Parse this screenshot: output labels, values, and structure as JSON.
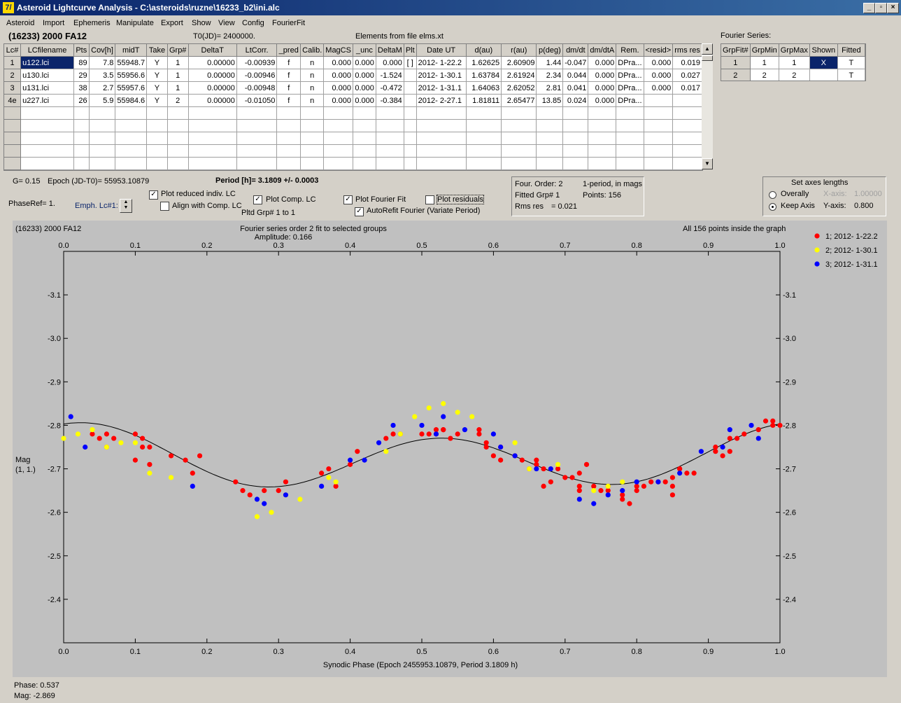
{
  "window": {
    "title": "Asteroid Lightcurve Analysis - C:\\asteroids\\ruzne\\16233_b2\\ini.alc",
    "icon": "7/",
    "controls": [
      "_",
      "▫",
      "×"
    ]
  },
  "menu": [
    "Asteroid",
    "Import",
    "Ephemeris",
    "Manipulate",
    "Export",
    "Show",
    "View",
    "Config",
    "FourierFit"
  ],
  "header": {
    "asteroid": "(16233) 2000 FA12",
    "t0": "T0(JD)= 2400000.",
    "elements": "Elements from file elms.xt",
    "fourier_label": "Fourier Series:"
  },
  "lc_table": {
    "columns": [
      "Lc#",
      "LCfilename",
      "Pts",
      "Cov[h]",
      "midT",
      "Take",
      "Grp#",
      "DeltaT",
      "LtCorr.",
      "_pred",
      "Calib.",
      "MagCS",
      "_unc",
      "DeltaM",
      "Plt",
      "Date UT",
      "d(au)",
      "r(au)",
      "p(deg)",
      "dm/dt",
      "dm/dtA",
      "Rem.",
      "<resid>",
      "rms res"
    ],
    "rows": [
      [
        "1",
        "u122.lci",
        "89",
        "7.8",
        "55948.7",
        "Y",
        "1",
        "0.00000",
        "-0.00939",
        "f",
        "n",
        "0.000",
        "0.000",
        "0.000",
        "[ ]",
        "2012- 1-22.2",
        "1.62625",
        "2.60909",
        "1.44",
        "-0.047",
        "0.000",
        "DPra...",
        "0.000",
        "0.019"
      ],
      [
        "2",
        "u130.lci",
        "29",
        "3.5",
        "55956.6",
        "Y",
        "1",
        "0.00000",
        "-0.00946",
        "f",
        "n",
        "0.000",
        "0.000",
        "-1.524",
        "",
        "2012- 1-30.1",
        "1.63784",
        "2.61924",
        "2.34",
        "0.044",
        "0.000",
        "DPra...",
        "0.000",
        "0.027"
      ],
      [
        "3",
        "u131.lci",
        "38",
        "2.7",
        "55957.6",
        "Y",
        "1",
        "0.00000",
        "-0.00948",
        "f",
        "n",
        "0.000",
        "0.000",
        "-0.472",
        "",
        "2012- 1-31.1",
        "1.64063",
        "2.62052",
        "2.81",
        "0.041",
        "0.000",
        "DPra...",
        "0.000",
        "0.017"
      ],
      [
        "4e",
        "u227.lci",
        "26",
        "5.9",
        "55984.6",
        "Y",
        "2",
        "0.00000",
        "-0.01050",
        "f",
        "n",
        "0.000",
        "0.000",
        "-0.384",
        "",
        "2012- 2-27.1",
        "1.81811",
        "2.65477",
        "13.85",
        "0.024",
        "0.000",
        "DPra...",
        "",
        ""
      ]
    ],
    "empty_rows": 5
  },
  "fourier_table": {
    "columns": [
      "GrpFit#",
      "GrpMin",
      "GrpMax",
      "Shown",
      "Fitted"
    ],
    "rows": [
      [
        "1",
        "1",
        "1",
        "X",
        "T"
      ],
      [
        "2",
        "2",
        "2",
        "",
        "T"
      ]
    ]
  },
  "info": {
    "g": "G= 0.15",
    "epoch": "Epoch (JD-T0)= 55953.10879",
    "period": "Period [h]= 3.1809 +/- 0.0003",
    "phaseref": "PhaseRef= 1.",
    "emph": "Emph. Lc#1:",
    "pltd_grp": "Pltd Grp#  1   to    1"
  },
  "options": {
    "plot_reduced": {
      "label": "Plot reduced indiv. LC",
      "checked": true
    },
    "align": {
      "label": "Align with Comp. LC",
      "checked": false
    },
    "plot_comp": {
      "label": "Plot Comp. LC",
      "checked": true
    },
    "plot_fourier": {
      "label": "Plot Fourier Fit",
      "checked": true
    },
    "plot_residuals": {
      "label": "Plot residuals",
      "checked": false
    },
    "autorefit": {
      "label": "AutoRefit Fourier (Variate Period)",
      "checked": true
    }
  },
  "fourier_info": {
    "order": "Four. Order:  2",
    "mode": "1-period, in mags",
    "fitted": "Fitted Grp# 1",
    "points": "Points: 156",
    "rms_label": "Rms res",
    "rms_value": "= 0.021"
  },
  "axes_panel": {
    "title": "Set axes lengths",
    "overally": "Overally",
    "keep": "Keep Axis",
    "xaxis_label": "X-axis:",
    "xaxis_value": "1.00000",
    "yaxis_label": "Y-axis:",
    "yaxis_value": "0.800",
    "selected": "keep"
  },
  "plot": {
    "top_left": "(16233) 2000 FA12",
    "title": "Fourier series order 2 fit to selected groups",
    "subtitle": "Amplitude: 0.166",
    "top_right": "All 156 points inside the graph",
    "ylabel_line1": "Mag",
    "ylabel_line2": "(1, 1.)",
    "xlabel": "Synodic Phase (Epoch 2455953.10879, Period 3.1809 h)"
  },
  "status": {
    "phase": "Phase:  0.537",
    "mag": "Mag:    -2.869"
  },
  "chart_data": {
    "type": "scatter",
    "xlim": [
      0,
      1
    ],
    "ylim": [
      -3.2,
      -2.3
    ],
    "y_inverted": true,
    "x_ticks": [
      "0.0",
      "0.1",
      "0.2",
      "0.3",
      "0.4",
      "0.5",
      "0.6",
      "0.7",
      "0.8",
      "0.9",
      "1.0"
    ],
    "y_ticks": [
      "-3.1",
      "-3.0",
      "-2.9",
      "-2.8",
      "-2.7",
      "-2.6",
      "-2.5",
      "-2.4"
    ],
    "fit": {
      "label": "Fourier fit",
      "color": "#000000",
      "mean": -2.725,
      "a1": -0.018,
      "b1": 0.0,
      "a2": -0.06,
      "b2": -0.02
    },
    "series": [
      {
        "name": "1; 2012- 1-22.2",
        "color": "#ff0000",
        "points": [
          [
            0.04,
            -2.78
          ],
          [
            0.05,
            -2.77
          ],
          [
            0.06,
            -2.78
          ],
          [
            0.06,
            -2.75
          ],
          [
            0.07,
            -2.77
          ],
          [
            0.1,
            -2.72
          ],
          [
            0.1,
            -2.78
          ],
          [
            0.11,
            -2.75
          ],
          [
            0.11,
            -2.77
          ],
          [
            0.12,
            -2.71
          ],
          [
            0.12,
            -2.75
          ],
          [
            0.15,
            -2.73
          ],
          [
            0.17,
            -2.72
          ],
          [
            0.18,
            -2.69
          ],
          [
            0.19,
            -2.73
          ],
          [
            0.24,
            -2.67
          ],
          [
            0.25,
            -2.65
          ],
          [
            0.26,
            -2.64
          ],
          [
            0.28,
            -2.65
          ],
          [
            0.3,
            -2.65
          ],
          [
            0.31,
            -2.67
          ],
          [
            0.36,
            -2.69
          ],
          [
            0.37,
            -2.7
          ],
          [
            0.38,
            -2.66
          ],
          [
            0.4,
            -2.71
          ],
          [
            0.41,
            -2.74
          ],
          [
            0.45,
            -2.77
          ],
          [
            0.46,
            -2.78
          ],
          [
            0.47,
            -2.78
          ],
          [
            0.5,
            -2.78
          ],
          [
            0.51,
            -2.78
          ],
          [
            0.52,
            -2.79
          ],
          [
            0.52,
            -2.78
          ],
          [
            0.53,
            -2.79
          ],
          [
            0.53,
            -2.79
          ],
          [
            0.54,
            -2.77
          ],
          [
            0.55,
            -2.78
          ],
          [
            0.58,
            -2.79
          ],
          [
            0.58,
            -2.78
          ],
          [
            0.59,
            -2.76
          ],
          [
            0.59,
            -2.75
          ],
          [
            0.6,
            -2.73
          ],
          [
            0.61,
            -2.75
          ],
          [
            0.61,
            -2.72
          ],
          [
            0.63,
            -2.73
          ],
          [
            0.64,
            -2.72
          ],
          [
            0.65,
            -2.7
          ],
          [
            0.66,
            -2.72
          ],
          [
            0.66,
            -2.71
          ],
          [
            0.67,
            -2.66
          ],
          [
            0.67,
            -2.7
          ],
          [
            0.68,
            -2.67
          ],
          [
            0.69,
            -2.7
          ],
          [
            0.7,
            -2.68
          ],
          [
            0.71,
            -2.68
          ],
          [
            0.72,
            -2.69
          ],
          [
            0.72,
            -2.66
          ],
          [
            0.72,
            -2.65
          ],
          [
            0.73,
            -2.71
          ],
          [
            0.74,
            -2.66
          ],
          [
            0.75,
            -2.65
          ],
          [
            0.76,
            -2.66
          ],
          [
            0.76,
            -2.65
          ],
          [
            0.78,
            -2.64
          ],
          [
            0.78,
            -2.63
          ],
          [
            0.79,
            -2.62
          ],
          [
            0.8,
            -2.65
          ],
          [
            0.8,
            -2.66
          ],
          [
            0.81,
            -2.66
          ],
          [
            0.82,
            -2.67
          ],
          [
            0.83,
            -2.67
          ],
          [
            0.84,
            -2.67
          ],
          [
            0.85,
            -2.64
          ],
          [
            0.85,
            -2.68
          ],
          [
            0.85,
            -2.66
          ],
          [
            0.86,
            -2.7
          ],
          [
            0.86,
            -2.7
          ],
          [
            0.87,
            -2.69
          ],
          [
            0.88,
            -2.69
          ],
          [
            0.91,
            -2.74
          ],
          [
            0.91,
            -2.75
          ],
          [
            0.92,
            -2.73
          ],
          [
            0.93,
            -2.77
          ],
          [
            0.93,
            -2.74
          ],
          [
            0.94,
            -2.77
          ],
          [
            0.95,
            -2.78
          ],
          [
            0.97,
            -2.79
          ],
          [
            0.98,
            -2.81
          ],
          [
            0.99,
            -2.81
          ],
          [
            0.99,
            -2.8
          ],
          [
            1.0,
            -2.8
          ]
        ]
      },
      {
        "name": "2; 2012- 1-30.1",
        "color": "#ffff00",
        "points": [
          [
            0.0,
            -2.77
          ],
          [
            0.02,
            -2.78
          ],
          [
            0.04,
            -2.79
          ],
          [
            0.06,
            -2.75
          ],
          [
            0.08,
            -2.76
          ],
          [
            0.1,
            -2.76
          ],
          [
            0.12,
            -2.69
          ],
          [
            0.15,
            -2.68
          ],
          [
            0.27,
            -2.59
          ],
          [
            0.29,
            -2.6
          ],
          [
            0.31,
            -2.64
          ],
          [
            0.33,
            -2.63
          ],
          [
            0.37,
            -2.68
          ],
          [
            0.38,
            -2.67
          ],
          [
            0.45,
            -2.74
          ],
          [
            0.47,
            -2.78
          ],
          [
            0.49,
            -2.82
          ],
          [
            0.51,
            -2.84
          ],
          [
            0.53,
            -2.85
          ],
          [
            0.55,
            -2.83
          ],
          [
            0.57,
            -2.82
          ],
          [
            0.63,
            -2.76
          ],
          [
            0.65,
            -2.7
          ],
          [
            0.69,
            -2.71
          ],
          [
            0.74,
            -2.65
          ],
          [
            0.76,
            -2.66
          ],
          [
            0.78,
            -2.67
          ]
        ]
      },
      {
        "name": "3; 2012- 1-31.1",
        "color": "#0000ff",
        "points": [
          [
            0.01,
            -2.82
          ],
          [
            0.03,
            -2.75
          ],
          [
            0.18,
            -2.66
          ],
          [
            0.27,
            -2.63
          ],
          [
            0.28,
            -2.62
          ],
          [
            0.31,
            -2.64
          ],
          [
            0.36,
            -2.66
          ],
          [
            0.4,
            -2.72
          ],
          [
            0.42,
            -2.72
          ],
          [
            0.44,
            -2.76
          ],
          [
            0.46,
            -2.8
          ],
          [
            0.5,
            -2.8
          ],
          [
            0.52,
            -2.78
          ],
          [
            0.53,
            -2.82
          ],
          [
            0.56,
            -2.79
          ],
          [
            0.6,
            -2.78
          ],
          [
            0.61,
            -2.75
          ],
          [
            0.63,
            -2.73
          ],
          [
            0.66,
            -2.7
          ],
          [
            0.68,
            -2.7
          ],
          [
            0.72,
            -2.63
          ],
          [
            0.74,
            -2.62
          ],
          [
            0.76,
            -2.64
          ],
          [
            0.78,
            -2.65
          ],
          [
            0.8,
            -2.67
          ],
          [
            0.83,
            -2.67
          ],
          [
            0.86,
            -2.69
          ],
          [
            0.89,
            -2.74
          ],
          [
            0.92,
            -2.75
          ],
          [
            0.93,
            -2.79
          ],
          [
            0.96,
            -2.8
          ],
          [
            0.97,
            -2.77
          ]
        ]
      }
    ]
  }
}
